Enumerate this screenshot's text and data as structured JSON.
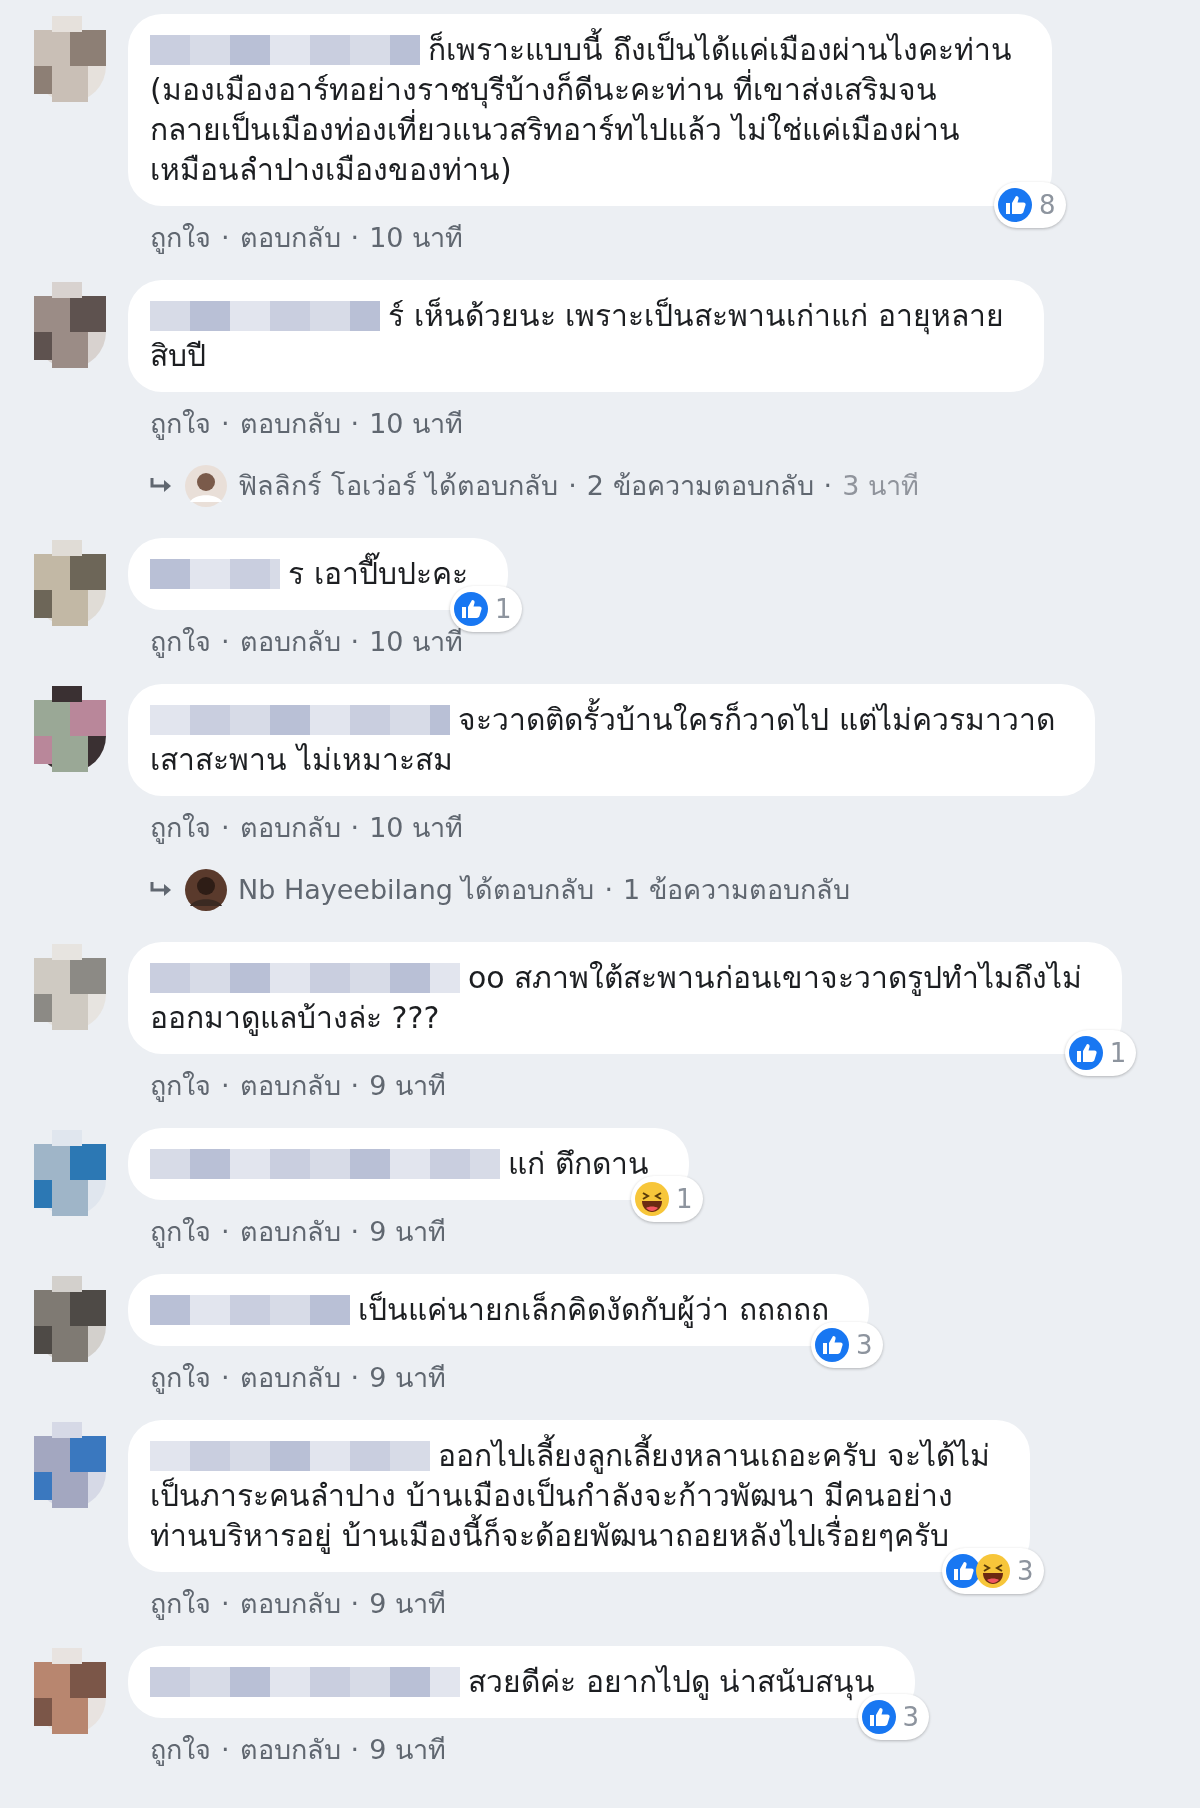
{
  "comments": [
    {
      "lines": [
        "ก็เพราะแบบนี้ ถึงเป็นได้แค่เมืองผ่านไงคะท่าน",
        "(มองเมืองอาร์ทอย่างราชบุรีบ้างก็ดีนะคะท่าน ที่เขาส่งเสริมจน",
        "กลายเป็นเมืองท่องเที่ยวแนวสริทอาร์ทไปแล้ว ไม่ใช่แค่เมืองผ่าน",
        "เหมือนลำปางเมืองของท่าน)"
      ],
      "reactions": [
        {
          "kind": "like"
        }
      ],
      "reaction_count": "8",
      "actions": [
        "ถูกใจ",
        "ตอบกลับ",
        "10 นาที"
      ],
      "separator": "·"
    },
    {
      "lines": [
        "ร์ เห็นด้วยนะ เพราะเป็นสะพานเก่าแก่ อายุหลาย",
        "สิบปี"
      ],
      "actions": [
        "ถูกใจ",
        "ตอบกลับ",
        "10 นาที"
      ],
      "separator": "·",
      "reply": {
        "author_action": "ฟิลลิกร์ โอเว่อร์ ได้ตอบกลับ",
        "count": "2 ข้อความตอบกลับ",
        "time": "3 นาที",
        "separator": "·"
      }
    },
    {
      "lines": [
        "ร เอาปี๊บปะคะ"
      ],
      "reactions": [
        {
          "kind": "like"
        }
      ],
      "reaction_count": "1",
      "actions": [
        "ถูกใจ",
        "ตอบกลับ",
        "10 นาที"
      ],
      "separator": "·"
    },
    {
      "lines": [
        "จะวาดติดรั้วบ้านใครก็วาดไป แต่ไม่ควรมาวาด",
        "เสาสะพาน ไม่เหมาะสม"
      ],
      "actions": [
        "ถูกใจ",
        "ตอบกลับ",
        "10 นาที"
      ],
      "separator": "·",
      "reply": {
        "author_action": "Nb Hayeebilang ได้ตอบกลับ",
        "count": "1 ข้อความตอบกลับ",
        "separator": "·"
      }
    },
    {
      "lines": [
        "oo สภาพใต้สะพานก่อนเขาจะวาดรูปทำไมถึงไม่",
        "ออกมาดูแลบ้างล่ะ ???"
      ],
      "reactions": [
        {
          "kind": "like"
        }
      ],
      "reaction_count": "1",
      "actions": [
        "ถูกใจ",
        "ตอบกลับ",
        "9 นาที"
      ],
      "separator": "·"
    },
    {
      "lines": [
        "แก่ ตึกดาน"
      ],
      "reactions": [
        {
          "kind": "haha"
        }
      ],
      "reaction_count": "1",
      "actions": [
        "ถูกใจ",
        "ตอบกลับ",
        "9 นาที"
      ],
      "separator": "·"
    },
    {
      "lines": [
        "เป็นแค่นายกเล็กคิดงัดกับผู้ว่า ถถถถถ"
      ],
      "reactions": [
        {
          "kind": "like"
        }
      ],
      "reaction_count": "3",
      "actions": [
        "ถูกใจ",
        "ตอบกลับ",
        "9 นาที"
      ],
      "separator": "·"
    },
    {
      "lines": [
        "ออกไปเลี้ยงลูกเลี้ยงหลานเถอะครับ จะได้ไม่",
        "เป็นภาระคนลำปาง บ้านเมืองเป็นกำลังจะก้าวพัฒนา มีคนอย่าง",
        "ท่านบริหารอยู่ บ้านเมืองนี้ก็จะด้อยพัฒนาถอยหลังไปเรื่อยๆครับ"
      ],
      "reactions": [
        {
          "kind": "like"
        },
        {
          "kind": "haha"
        }
      ],
      "reaction_count": "3",
      "actions": [
        "ถูกใจ",
        "ตอบกลับ",
        "9 นาที"
      ],
      "separator": "·"
    },
    {
      "lines": [
        "สวยดีค่ะ อยากไปดู น่าสนับสนุน"
      ],
      "reactions": [
        {
          "kind": "like"
        }
      ],
      "reaction_count": "3",
      "actions": [
        "ถูกใจ",
        "ตอบกลับ",
        "9 นาที"
      ],
      "separator": "·"
    }
  ]
}
